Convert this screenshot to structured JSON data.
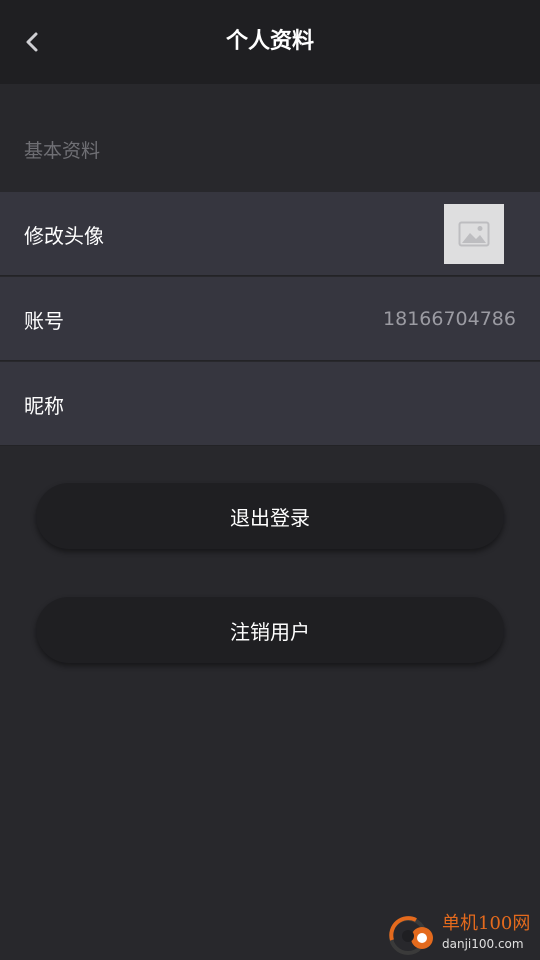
{
  "header": {
    "title": "个人资料",
    "back_icon": "chevron-left-icon"
  },
  "section": {
    "title": "基本资料"
  },
  "rows": [
    {
      "label": "修改头像",
      "icon": "image-placeholder-icon"
    },
    {
      "label": "账号",
      "value": "18166704786"
    },
    {
      "label": "昵称",
      "value": ""
    }
  ],
  "buttons": {
    "logout": "退出登录",
    "deactivate": "注销用户"
  },
  "watermark": {
    "title": "单机100网",
    "url": "danji100.com"
  },
  "colors": {
    "background": "#28282c",
    "topbar": "#1f1f22",
    "row": "#36363f",
    "button": "#1f1f22",
    "watermark_accent": "#e46a1d"
  }
}
